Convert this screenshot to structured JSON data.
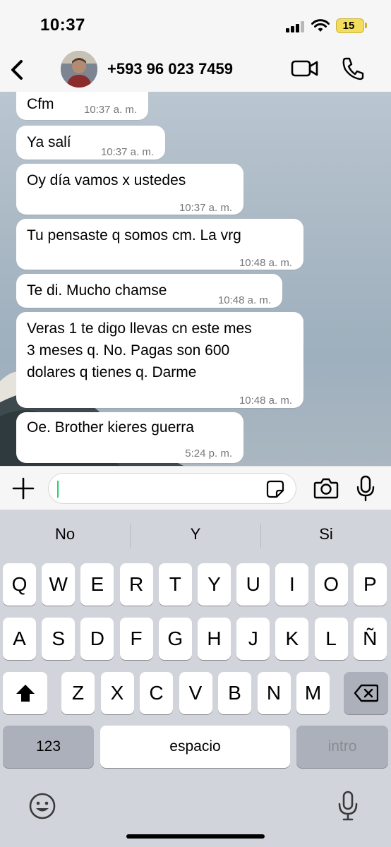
{
  "status_bar": {
    "time": "10:37",
    "battery": "15",
    "icons": [
      "signal-icon",
      "wifi-icon",
      "battery-icon"
    ]
  },
  "header": {
    "back_icon": "chevron-left-icon",
    "contact": "+593 96 023 7459",
    "actions": [
      "video-call-icon",
      "phone-icon"
    ]
  },
  "messages": [
    {
      "text": "Cfm",
      "time": "10:37 a. m."
    },
    {
      "text": "Ya salí",
      "time": "10:37 a. m."
    },
    {
      "text": "Oy día vamos x ustedes",
      "time": "10:37 a. m."
    },
    {
      "text": "Tu pensaste q somos cm. La vrg",
      "time": "10:48 a. m."
    },
    {
      "text": "Te di. Mucho chamse",
      "time": "10:48 a. m."
    },
    {
      "text": "Veras 1 te digo llevas cn este mes\n3 meses q. No. Pagas son 600\ndolares q tienes q. Darme",
      "time": "10:48 a. m."
    },
    {
      "text": "Oe. Brother kieres guerra",
      "time": "5:24 p. m."
    }
  ],
  "input": {
    "value": "",
    "icons": [
      "plus-icon",
      "sticker-icon",
      "camera-icon",
      "microphone-icon"
    ]
  },
  "keyboard": {
    "suggestions": [
      "No",
      "Y",
      "Si"
    ],
    "row1": [
      "Q",
      "W",
      "E",
      "R",
      "T",
      "Y",
      "U",
      "I",
      "O",
      "P"
    ],
    "row2": [
      "A",
      "S",
      "D",
      "F",
      "G",
      "H",
      "J",
      "K",
      "L",
      "Ñ"
    ],
    "row3": [
      "Z",
      "X",
      "C",
      "V",
      "B",
      "N",
      "M"
    ],
    "numbers_key": "123",
    "space_key": "espacio",
    "return_key": "intro",
    "icons": [
      "shift-icon",
      "backspace-icon",
      "emoji-icon",
      "dictation-icon"
    ]
  },
  "colors": {
    "accent": "#25d366",
    "bubble": "#ffffff",
    "keyboard_bg": "#d1d4da"
  }
}
